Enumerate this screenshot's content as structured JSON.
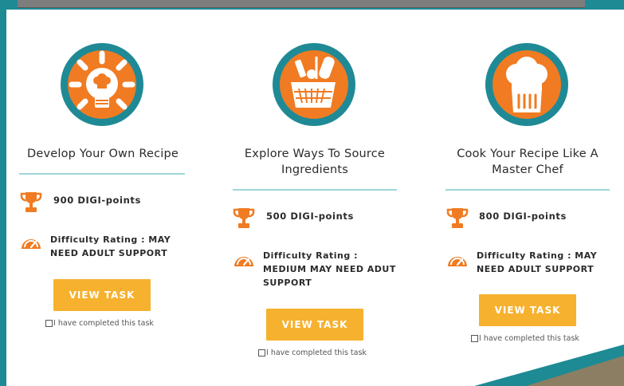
{
  "accent": "#f07b22",
  "teal": "#1f8a95",
  "button_color": "#f6b12e",
  "cards": [
    {
      "icon": "lightbulb-chef-hat-icon",
      "title": "Develop Your Own Recipe",
      "points": "900 DIGI-points",
      "difficulty": "Difficulty Rating : MAY NEED ADULT SUPPORT",
      "difficulty_lines": [
        "Difficulty Rating : MAY",
        "NEED ADULT SUPPORT"
      ],
      "button": "VIEW TASK",
      "completed_label": "I have completed this task"
    },
    {
      "icon": "shopping-basket-icon",
      "title": "Explore Ways To Source Ingredients",
      "title_lines": [
        "Explore Ways To Source",
        "Ingredients"
      ],
      "points": "500 DIGI-points",
      "difficulty": "Difficulty Rating : MEDIUM MAY NEED ADUT SUPPORT",
      "difficulty_lines": [
        "Difficulty Rating :",
        "MEDIUM MAY NEED ADUT",
        "SUPPORT"
      ],
      "button": "VIEW TASK",
      "completed_label": "I have completed this task"
    },
    {
      "icon": "chef-hat-icon",
      "title": "Cook Your Recipe Like A Master Chef",
      "title_lines": [
        "Cook Your Recipe Like A",
        "Master Chef"
      ],
      "points": "800 DIGI-points",
      "difficulty": "Difficulty Rating : MAY NEED ADULT SUPPORT",
      "difficulty_lines": [
        "Difficulty Rating : MAY",
        "NEED ADULT SUPPORT"
      ],
      "button": "VIEW TASK",
      "completed_label": "I have completed this task"
    }
  ]
}
